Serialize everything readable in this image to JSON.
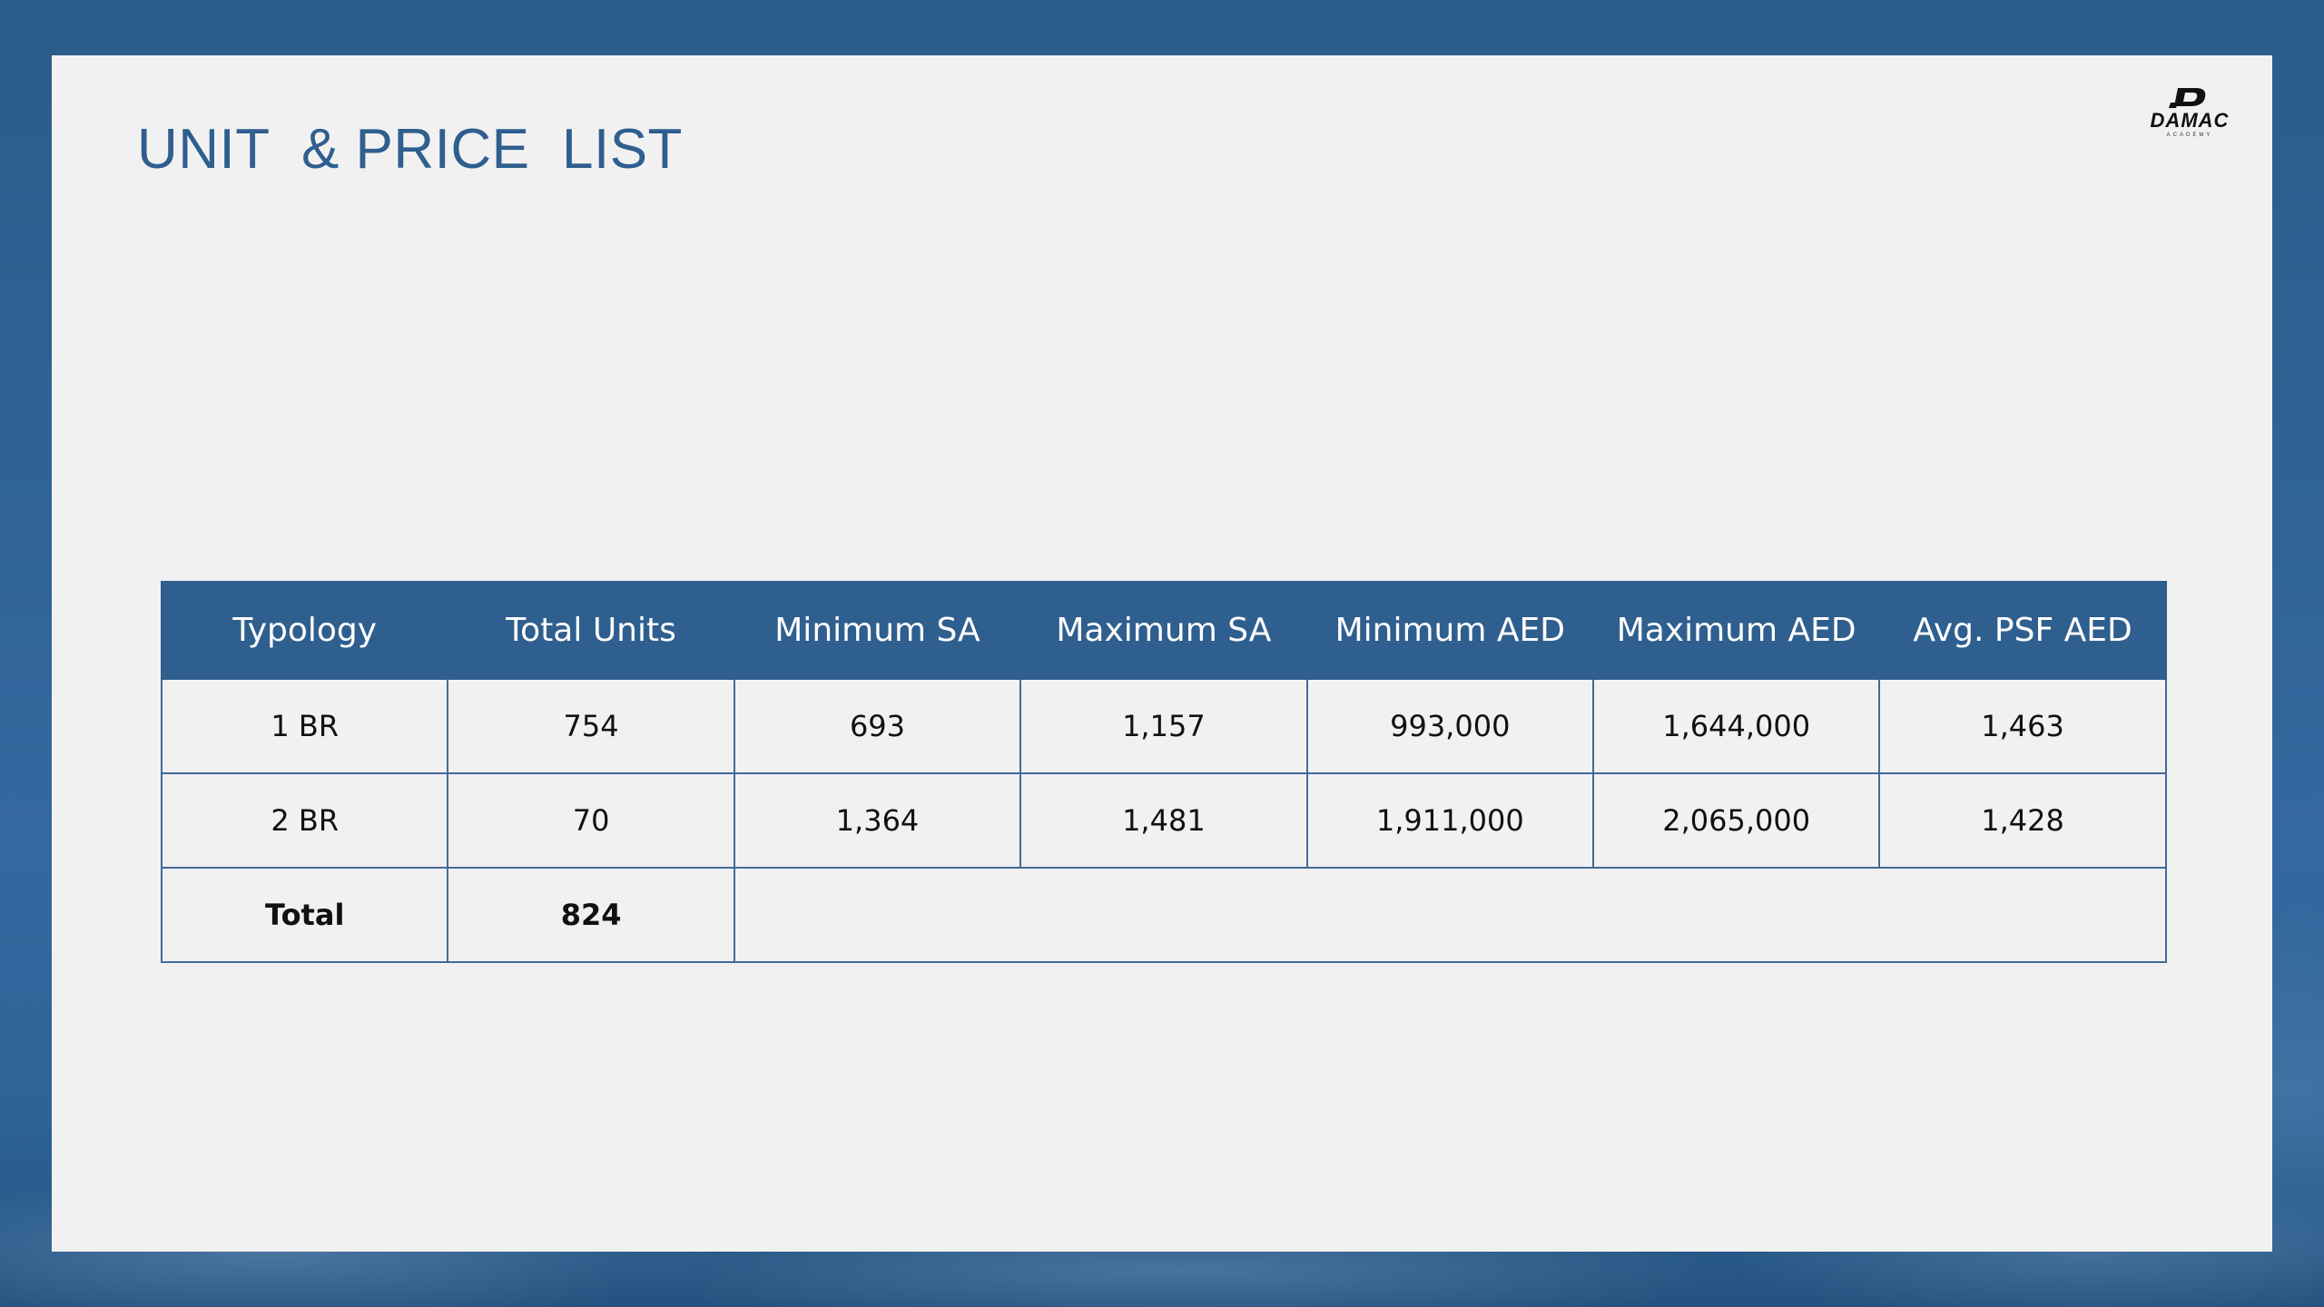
{
  "slide": {
    "title": "UNIT  & PRICE  LIST",
    "logo": {
      "wordmark": "DAMAC",
      "subtitle": "ACADEMY"
    }
  },
  "table": {
    "headers": [
      "Typology",
      "Total Units",
      "Minimum SA",
      "Maximum SA",
      "Minimum AED",
      "Maximum AED",
      "Avg. PSF AED"
    ],
    "rows": [
      [
        "1 BR",
        "754",
        "693",
        "1,157",
        "993,000",
        "1,644,000",
        "1,463"
      ],
      [
        "2 BR",
        "70",
        "1,364",
        "1,481",
        "1,911,000",
        "2,065,000",
        "1,428"
      ]
    ],
    "total": {
      "label": "Total",
      "units": "824"
    }
  },
  "colors": {
    "accent": "#2f5f8e",
    "slide_background": "#f2f1f2",
    "frame_background": "#2f6395"
  }
}
